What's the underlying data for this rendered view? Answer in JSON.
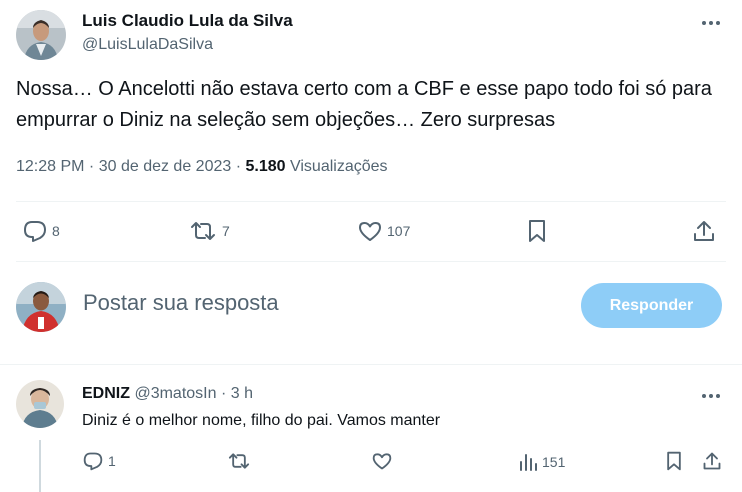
{
  "tweet": {
    "author_name": "Luis Claudio Lula da Silva",
    "author_handle": "@LuisLulaDaSilva",
    "text": "Nossa… O Ancelotti não estava certo com a CBF e esse papo todo foi só para empurrar o Diniz na seleção sem objeções… Zero surpresas",
    "time": "12:28 PM · 30 de dez de 2023 · ",
    "views_count": "5.180",
    "views_label": " Visualizações",
    "actions": {
      "replies": "8",
      "retweets": "7",
      "likes": "107"
    }
  },
  "composer": {
    "placeholder": "Postar sua resposta",
    "button_label": "Responder"
  },
  "reply": {
    "author_name": "EDNIZ",
    "handle_time": " @3matosIn · 3 h",
    "text": "Diniz é o melhor nome, filho do pai.  Vamos manter",
    "actions": {
      "replies": "1",
      "views": "151"
    }
  },
  "colors": {
    "accent": "#1d9bf0",
    "button_disabled": "#8ecdf7",
    "muted": "#536471",
    "text": "#0f1419"
  }
}
